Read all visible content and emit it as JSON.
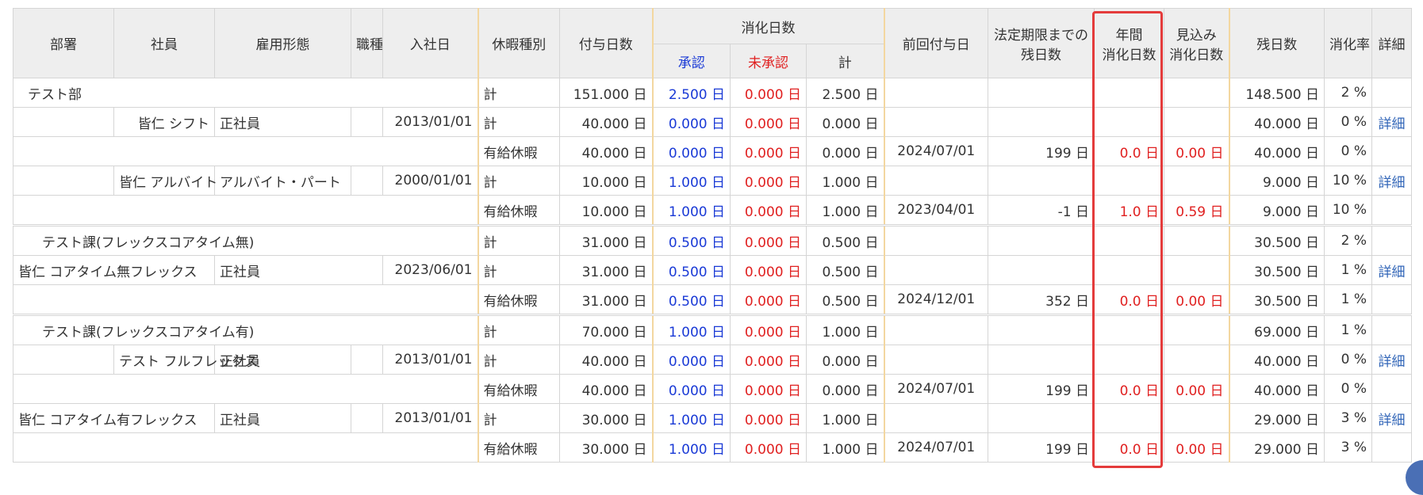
{
  "headers": {
    "dept": "部署",
    "employee": "社員",
    "employment_type": "雇用形態",
    "job_type": "職種",
    "join_date": "入社日",
    "leave_type": "休暇種別",
    "granted_days": "付与日数",
    "used_days": "消化日数",
    "approved": "承認",
    "unapproved": "未承認",
    "total": "計",
    "prev_grant_date": "前回付与日",
    "legal_deadline_line1": "法定期限までの",
    "legal_deadline_line2": "残日数",
    "annual_used_line1": "年間",
    "annual_used_line2": "消化日数",
    "expected_line1": "見込み",
    "expected_line2": "消化日数",
    "remaining": "残日数",
    "usage_rate": "消化率",
    "detail": "詳細"
  },
  "rows": [
    {
      "dept": "テスト部",
      "employee": "",
      "emp_type": "",
      "job": "",
      "join": "",
      "leave": "計",
      "granted": "151.000 日",
      "approved": "2.500 日",
      "unapproved": "0.000 日",
      "total": "2.500 日",
      "prev": "",
      "deadline": "",
      "annual": "",
      "expected": "",
      "remaining": "148.500 日",
      "rate": "2 %",
      "detail": ""
    },
    {
      "dept": "",
      "employee": "皆仁 シフト",
      "emp_type": "正社員",
      "job": "",
      "join": "2013/01/01",
      "leave": "計",
      "granted": "40.000 日",
      "approved": "0.000 日",
      "unapproved": "0.000 日",
      "total": "0.000 日",
      "prev": "",
      "deadline": "",
      "annual": "",
      "expected": "",
      "remaining": "40.000 日",
      "rate": "0 %",
      "detail": "詳細"
    },
    {
      "dept": "",
      "employee": "",
      "emp_type": "",
      "job": "",
      "join": "",
      "leave": "有給休暇",
      "granted": "40.000 日",
      "approved": "0.000 日",
      "unapproved": "0.000 日",
      "total": "0.000 日",
      "prev": "2024/07/01",
      "deadline": "199 日",
      "annual": "0.0 日",
      "expected": "0.00 日",
      "remaining": "40.000 日",
      "rate": "0 %",
      "detail": ""
    },
    {
      "dept": "",
      "employee": "皆仁 アルバイト",
      "emp_type": "アルバイト・パート",
      "job": "",
      "join": "2000/01/01",
      "leave": "計",
      "granted": "10.000 日",
      "approved": "1.000 日",
      "unapproved": "0.000 日",
      "total": "1.000 日",
      "prev": "",
      "deadline": "",
      "annual": "",
      "expected": "",
      "remaining": "9.000 日",
      "rate": "10 %",
      "detail": "詳細"
    },
    {
      "dept": "",
      "employee": "",
      "emp_type": "",
      "job": "",
      "join": "",
      "leave": "有給休暇",
      "granted": "10.000 日",
      "approved": "1.000 日",
      "unapproved": "0.000 日",
      "total": "1.000 日",
      "prev": "2023/04/01",
      "deadline": "-1 日",
      "annual": "1.0 日",
      "expected": "0.59 日",
      "remaining": "9.000 日",
      "rate": "10 %",
      "detail": ""
    },
    {
      "dept": "テスト課(フレックスコアタイム無)",
      "employee": "",
      "emp_type": "",
      "job": "",
      "join": "",
      "leave": "計",
      "granted": "31.000 日",
      "approved": "0.500 日",
      "unapproved": "0.000 日",
      "total": "0.500 日",
      "prev": "",
      "deadline": "",
      "annual": "",
      "expected": "",
      "remaining": "30.500 日",
      "rate": "2 %",
      "detail": ""
    },
    {
      "dept": "",
      "employee": "皆仁 コアタイム無フレックス",
      "emp_type": "正社員",
      "job": "",
      "join": "2023/06/01",
      "leave": "計",
      "granted": "31.000 日",
      "approved": "0.500 日",
      "unapproved": "0.000 日",
      "total": "0.500 日",
      "prev": "",
      "deadline": "",
      "annual": "",
      "expected": "",
      "remaining": "30.500 日",
      "rate": "1 %",
      "detail": "詳細"
    },
    {
      "dept": "",
      "employee": "",
      "emp_type": "",
      "job": "",
      "join": "",
      "leave": "有給休暇",
      "granted": "31.000 日",
      "approved": "0.500 日",
      "unapproved": "0.000 日",
      "total": "0.500 日",
      "prev": "2024/12/01",
      "deadline": "352 日",
      "annual": "0.0 日",
      "expected": "0.00 日",
      "remaining": "30.500 日",
      "rate": "1 %",
      "detail": ""
    },
    {
      "dept": "テスト課(フレックスコアタイム有)",
      "employee": "",
      "emp_type": "",
      "job": "",
      "join": "",
      "leave": "計",
      "granted": "70.000 日",
      "approved": "1.000 日",
      "unapproved": "0.000 日",
      "total": "1.000 日",
      "prev": "",
      "deadline": "",
      "annual": "",
      "expected": "",
      "remaining": "69.000 日",
      "rate": "1 %",
      "detail": ""
    },
    {
      "dept": "",
      "employee": "テスト フルフレックス",
      "emp_type": "正社員",
      "job": "",
      "join": "2013/01/01",
      "leave": "計",
      "granted": "40.000 日",
      "approved": "0.000 日",
      "unapproved": "0.000 日",
      "total": "0.000 日",
      "prev": "",
      "deadline": "",
      "annual": "",
      "expected": "",
      "remaining": "40.000 日",
      "rate": "0 %",
      "detail": "詳細"
    },
    {
      "dept": "",
      "employee": "",
      "emp_type": "",
      "job": "",
      "join": "",
      "leave": "有給休暇",
      "granted": "40.000 日",
      "approved": "0.000 日",
      "unapproved": "0.000 日",
      "total": "0.000 日",
      "prev": "2024/07/01",
      "deadline": "199 日",
      "annual": "0.0 日",
      "expected": "0.00 日",
      "remaining": "40.000 日",
      "rate": "0 %",
      "detail": ""
    },
    {
      "dept": "",
      "employee": "皆仁 コアタイム有フレックス",
      "emp_type": "正社員",
      "job": "",
      "join": "2013/01/01",
      "leave": "計",
      "granted": "30.000 日",
      "approved": "1.000 日",
      "unapproved": "0.000 日",
      "total": "1.000 日",
      "prev": "",
      "deadline": "",
      "annual": "",
      "expected": "",
      "remaining": "29.000 日",
      "rate": "3 %",
      "detail": "詳細"
    },
    {
      "dept": "",
      "employee": "",
      "emp_type": "",
      "job": "",
      "join": "",
      "leave": "有給休暇",
      "granted": "30.000 日",
      "approved": "1.000 日",
      "unapproved": "0.000 日",
      "total": "1.000 日",
      "prev": "2024/07/01",
      "deadline": "199 日",
      "annual": "0.0 日",
      "expected": "0.00 日",
      "remaining": "29.000 日",
      "rate": "3 %",
      "detail": ""
    }
  ]
}
